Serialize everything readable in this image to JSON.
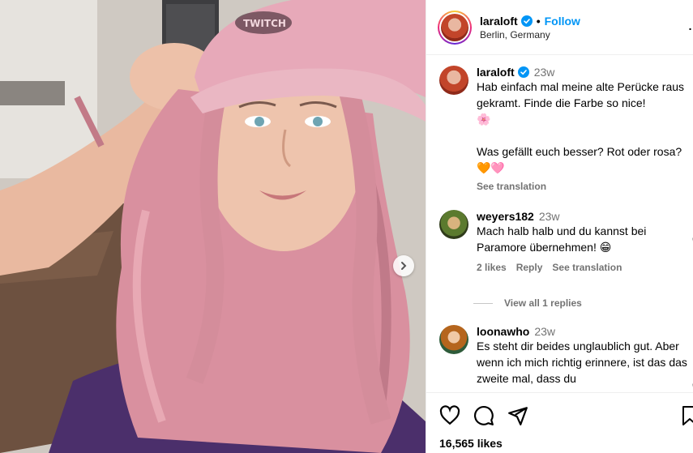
{
  "header": {
    "username": "laraloft",
    "separator": "•",
    "follow_label": "Follow",
    "location": "Berlin, Germany",
    "more": "…"
  },
  "caption": {
    "username": "laraloft",
    "time": "23w",
    "text": "Hab einfach mal meine alte Perücke raus gekramt. Finde die Farbe so nice!\n🌸\n\nWas gefällt euch besser? Rot oder rosa?\n🧡🩷",
    "see_translation": "See translation"
  },
  "comments": [
    {
      "username": "weyers182",
      "time": "23w",
      "text": "Mach halb halb und du kannst bei Paramore übernehmen! 😁",
      "likes": "2 likes",
      "reply": "Reply",
      "see_translation": "See translation"
    },
    {
      "username": "loonawho",
      "time": "23w",
      "text": "Es steht dir beides unglaublich gut. Aber wenn ich mich richtig erinnere, ist das das zweite mal, dass du"
    }
  ],
  "view_replies": "View all 1 replies",
  "likes_count": "16,565 likes",
  "colors": {
    "follow": "#0095f6",
    "secondary_text": "#737373",
    "border": "#efefef"
  },
  "icons": [
    "verified-icon",
    "heart-icon",
    "comment-icon",
    "share-icon",
    "bookmark-icon",
    "next-arrow-icon"
  ]
}
